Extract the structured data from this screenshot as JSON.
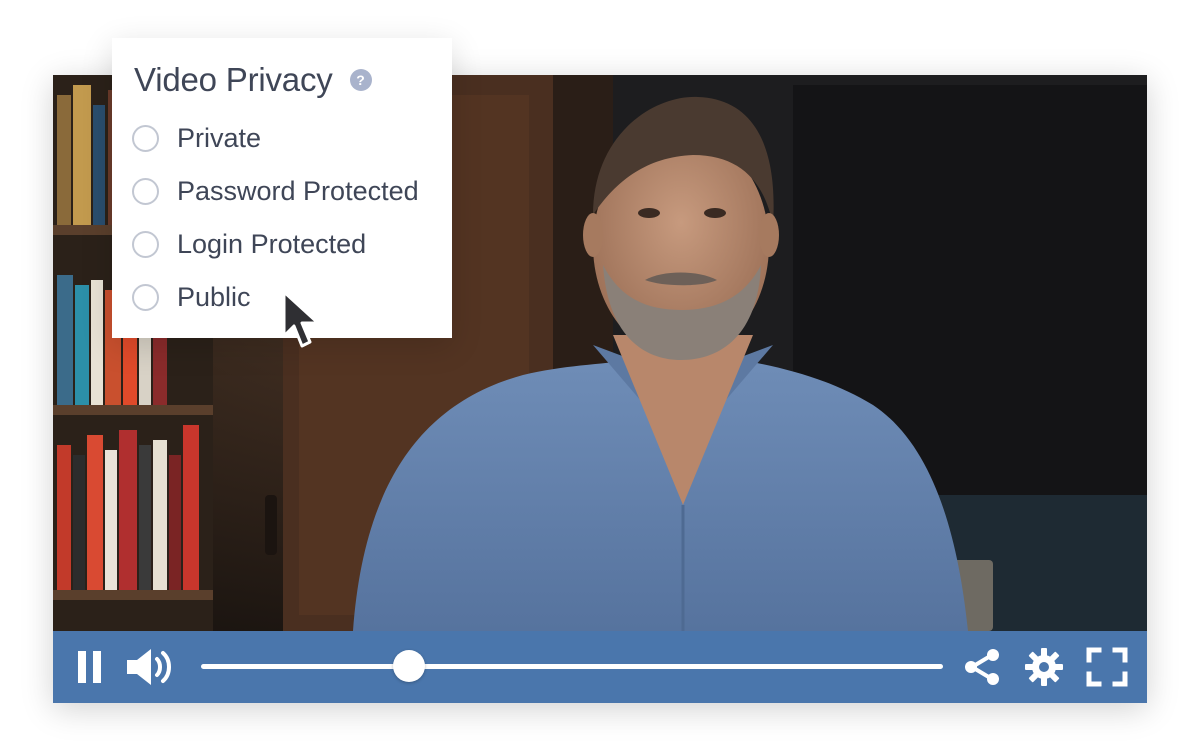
{
  "privacy": {
    "title": "Video Privacy",
    "help_glyph": "?",
    "options": [
      {
        "label": "Private",
        "selected": false
      },
      {
        "label": "Password Protected",
        "selected": false
      },
      {
        "label": "Login Protected",
        "selected": false
      },
      {
        "label": "Public",
        "selected": false
      }
    ]
  },
  "player": {
    "progress": 0.28,
    "controls": {
      "pause_icon": "pause-icon",
      "volume_icon": "volume-icon",
      "share_icon": "share-icon",
      "settings_icon": "gear-icon",
      "fullscreen_icon": "fullscreen-icon"
    }
  },
  "colors": {
    "control_bar": "#4a76ac",
    "control_icon": "#ffffff",
    "panel_text": "#3f4657",
    "radio_border": "#c2c7d2",
    "help_badge": "#a9b3cc"
  }
}
